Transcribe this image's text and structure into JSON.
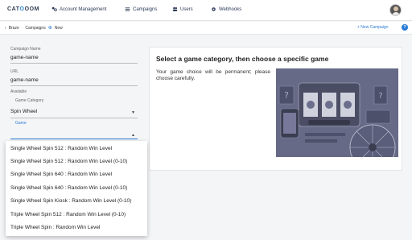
{
  "header": {
    "logo_prefix": "CAT",
    "logo_o": "O",
    "logo_suffix": "OOM",
    "nav": [
      {
        "label": "Account Management",
        "icon": "people-settings-icon"
      },
      {
        "label": "Campaigns",
        "icon": "list-icon"
      },
      {
        "label": "Users",
        "icon": "users-icon"
      },
      {
        "label": "Webhooks",
        "icon": "gear-icon"
      }
    ]
  },
  "subbar": {
    "back": "‹",
    "crumbs": [
      "Braze",
      "Campaigns"
    ],
    "current": "New",
    "new_campaign": "+ New Campaign",
    "help": "?"
  },
  "form": {
    "campaign_name_label": "Campaign Name",
    "campaign_name_value": "game-name",
    "url_label": "URL",
    "url_value": "game-name",
    "available_label": "Available",
    "game_category_label": "Game Category",
    "game_category_value": "Spin Wheel",
    "game_label": "Game"
  },
  "panel": {
    "title": "Select a game category, then choose a specific game",
    "description": "Your game choice will be permanent; please choose carefully."
  },
  "dropdown": {
    "options": [
      "Single Wheel Spin 512 : Random Win Level",
      "Single Wheel Spin 512 : Random Win Level (0-10)",
      "Single Wheel Spin 640 : Random Win Level",
      "Single Wheel Spin 640 : Random Win Level (0-10)",
      "Single Wheel Spin Kiosk : Random Win Level (0-10)",
      "Triple Wheel Spin 512 : Random Win Level (0-10)",
      "Triple Wheel Spin : Random Win Level"
    ]
  }
}
